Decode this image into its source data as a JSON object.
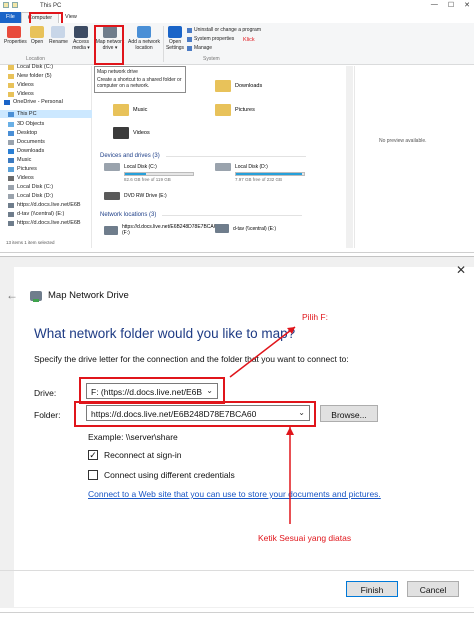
{
  "explorer": {
    "title": "This PC",
    "tabs": [
      "File",
      "Computer",
      "View"
    ],
    "ribbon": {
      "properties": "Properties",
      "open": "Open",
      "rename": "Rename",
      "access_media": "Access media ▾",
      "map_network_drive": "Map network drive ▾",
      "add_network_location": "Add a network location",
      "open_settings": "Open Settings",
      "uninstall": "Uninstall or change a program",
      "system_properties": "System properties",
      "manage": "Manage",
      "group_location": "Location",
      "group_system": "System",
      "klick": "Klick"
    },
    "tooltip": {
      "title": "Map network drive",
      "body": "Create a shortcut to a shared folder or computer on a network."
    },
    "nav": [
      "Local Disk (C:)",
      "New folder (5)",
      "Videos",
      "Videos",
      "OneDrive - Personal",
      "This PC",
      "3D Objects",
      "Desktop",
      "Documents",
      "Downloads",
      "Music",
      "Pictures",
      "Videos",
      "Local Disk (C:)",
      "Local Disk (D:)",
      "https://d.docs.live.net/E6B",
      "d-tav (\\\\central) (E:)",
      "https://d.docs.live.net/E6B"
    ],
    "status": "13 items   1 item selected",
    "folders": [
      "Downloads",
      "Music",
      "Pictures",
      "Videos"
    ],
    "devices_header": "Devices and drives (3)",
    "drives": [
      {
        "name": "Local Disk (C:)",
        "free": "82.6 GB free of 119 GB",
        "fill": 0.31
      },
      {
        "name": "Local Disk (D:)",
        "free": "7.97 GB free of 232 GB",
        "fill": 0.97
      },
      {
        "name": "DVD RW Drive (E:)",
        "free": "",
        "fill": 0
      }
    ],
    "network_header": "Network locations (3)",
    "network": [
      "https://d.docs.live.net/E6B248D78E7BCA60 (F:)",
      "d-tav (\\\\central) (E:)"
    ],
    "preview": "No preview available."
  },
  "dialog": {
    "title": "Map Network Drive",
    "heading": "What network folder would you like to map?",
    "instruction": "Specify the drive letter for the connection and the folder that you want to connect to:",
    "drive_label": "Drive:",
    "drive_value": "F: (https://d.docs.live.net/E6B",
    "folder_label": "Folder:",
    "folder_value": "https://d.docs.live.net/E6B248D78E7BCA60",
    "browse": "Browse...",
    "example": "Example: \\\\server\\share",
    "reconnect": "Reconnect at sign-in",
    "reconnect_checked": true,
    "different_credentials": "Connect using different credentials",
    "different_credentials_checked": false,
    "link": "Connect to a Web site that you can use to store your documents and pictures.",
    "finish": "Finish",
    "cancel": "Cancel",
    "annotation_pick": "Pilih F:",
    "annotation_type": "Ketik Sesuai yang diatas"
  },
  "colors": {
    "accent_red": "#e0151b",
    "heading_blue": "#1e3b84",
    "file_tab_blue": "#1a64c8"
  }
}
